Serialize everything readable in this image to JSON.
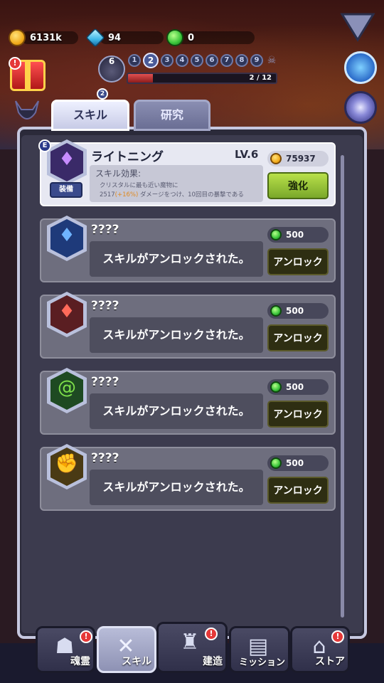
{
  "resources": {
    "gold": "6131k",
    "gems": "94",
    "green_orbs": "0"
  },
  "stage": {
    "number": "6",
    "waves": [
      "1",
      "2",
      "3",
      "4",
      "5",
      "6",
      "7",
      "8",
      "9"
    ],
    "current_wave": "2",
    "progress_text": "2 / 12",
    "progress": 0.1667,
    "stage_badge": "2"
  },
  "tabs": {
    "skill": "スキル",
    "research": "研究"
  },
  "active_skill": {
    "name": "ライトニング",
    "level": "LV.6",
    "cost": "75937",
    "effect_title": "スキル効果:",
    "effect_line1": "クリスタルに最も近い魔物に",
    "effect_line2_a": "2517",
    "effect_line2_b": "(+16%)",
    "effect_line2_c": "ダメージをつけ、10回目の暴撃である",
    "equip_label": "装備",
    "upgrade_label": "強化",
    "badge": "E"
  },
  "locked_skills": [
    {
      "name": "????",
      "cost": "500",
      "message": "スキルがアンロックされた。",
      "button": "アンロック",
      "element": "water"
    },
    {
      "name": "????",
      "cost": "500",
      "message": "スキルがアンロックされた。",
      "button": "アンロック",
      "element": "fire"
    },
    {
      "name": "????",
      "cost": "500",
      "message": "スキルがアンロックされた。",
      "button": "アンロック",
      "element": "wind"
    },
    {
      "name": "????",
      "cost": "500",
      "message": "スキルがアンロックされた。",
      "button": "アンロック",
      "element": "strength"
    }
  ],
  "nav": {
    "soul": "魂霊",
    "skill": "スキル",
    "build": "建造",
    "mission": "ミッション",
    "store": "ストア",
    "alert_mark": "!"
  },
  "colors": {
    "upgrade_green": "#9ccc3a",
    "panel_frame": "#c6c8e0",
    "highlight_orange": "#e08a20"
  }
}
